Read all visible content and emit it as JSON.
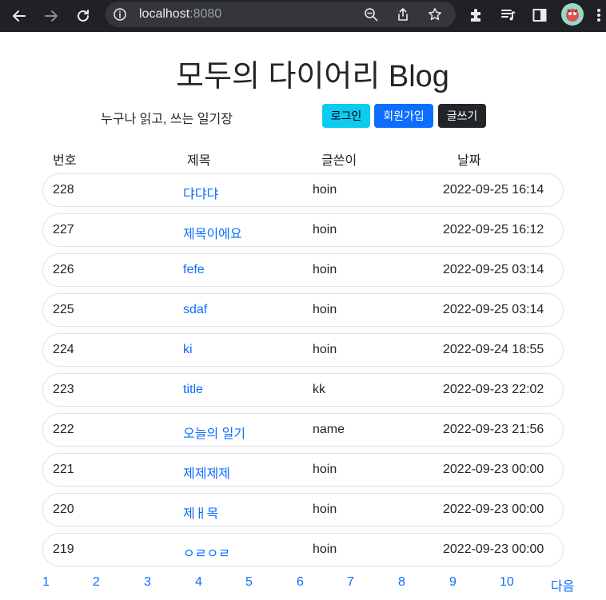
{
  "browser": {
    "url_host": "localhost",
    "url_port": ":8080"
  },
  "header": {
    "title": "모두의 다이어리 Blog",
    "subtitle": "누구나 읽고, 쓰는 일기장",
    "login_label": "로그인",
    "signup_label": "회원가입",
    "write_label": "글쓰기"
  },
  "table": {
    "columns": [
      "번호",
      "제목",
      "글쓴이",
      "날짜"
    ],
    "rows": [
      {
        "num": "228",
        "title": "댜댜댜",
        "writer": "hoin",
        "date": "2022-09-25 16:14"
      },
      {
        "num": "227",
        "title": "제목이에요",
        "writer": "hoin",
        "date": "2022-09-25 16:12"
      },
      {
        "num": "226",
        "title": "fefe",
        "writer": "hoin",
        "date": "2022-09-25 03:14"
      },
      {
        "num": "225",
        "title": "sdaf",
        "writer": "hoin",
        "date": "2022-09-25 03:14"
      },
      {
        "num": "224",
        "title": "ki",
        "writer": "hoin",
        "date": "2022-09-24 18:55"
      },
      {
        "num": "223",
        "title": "title",
        "writer": "kk",
        "date": "2022-09-23 22:02"
      },
      {
        "num": "222",
        "title": "오늘의 일기",
        "writer": "name",
        "date": "2022-09-23 21:56"
      },
      {
        "num": "221",
        "title": "제제제제",
        "writer": "hoin",
        "date": "2022-09-23 00:00"
      },
      {
        "num": "220",
        "title": "제ㅐ목",
        "writer": "hoin",
        "date": "2022-09-23 00:00"
      },
      {
        "num": "219",
        "title": "ㅇㄹㅇㄹ",
        "writer": "hoin",
        "date": "2022-09-23 00:00"
      }
    ]
  },
  "pagination": {
    "pages": [
      "1",
      "2",
      "3",
      "4",
      "5",
      "6",
      "7",
      "8",
      "9",
      "10"
    ],
    "next_label": "다음"
  },
  "colors": {
    "link": "#0d6efd",
    "info": "#0dcaf0",
    "dark": "#212529"
  }
}
